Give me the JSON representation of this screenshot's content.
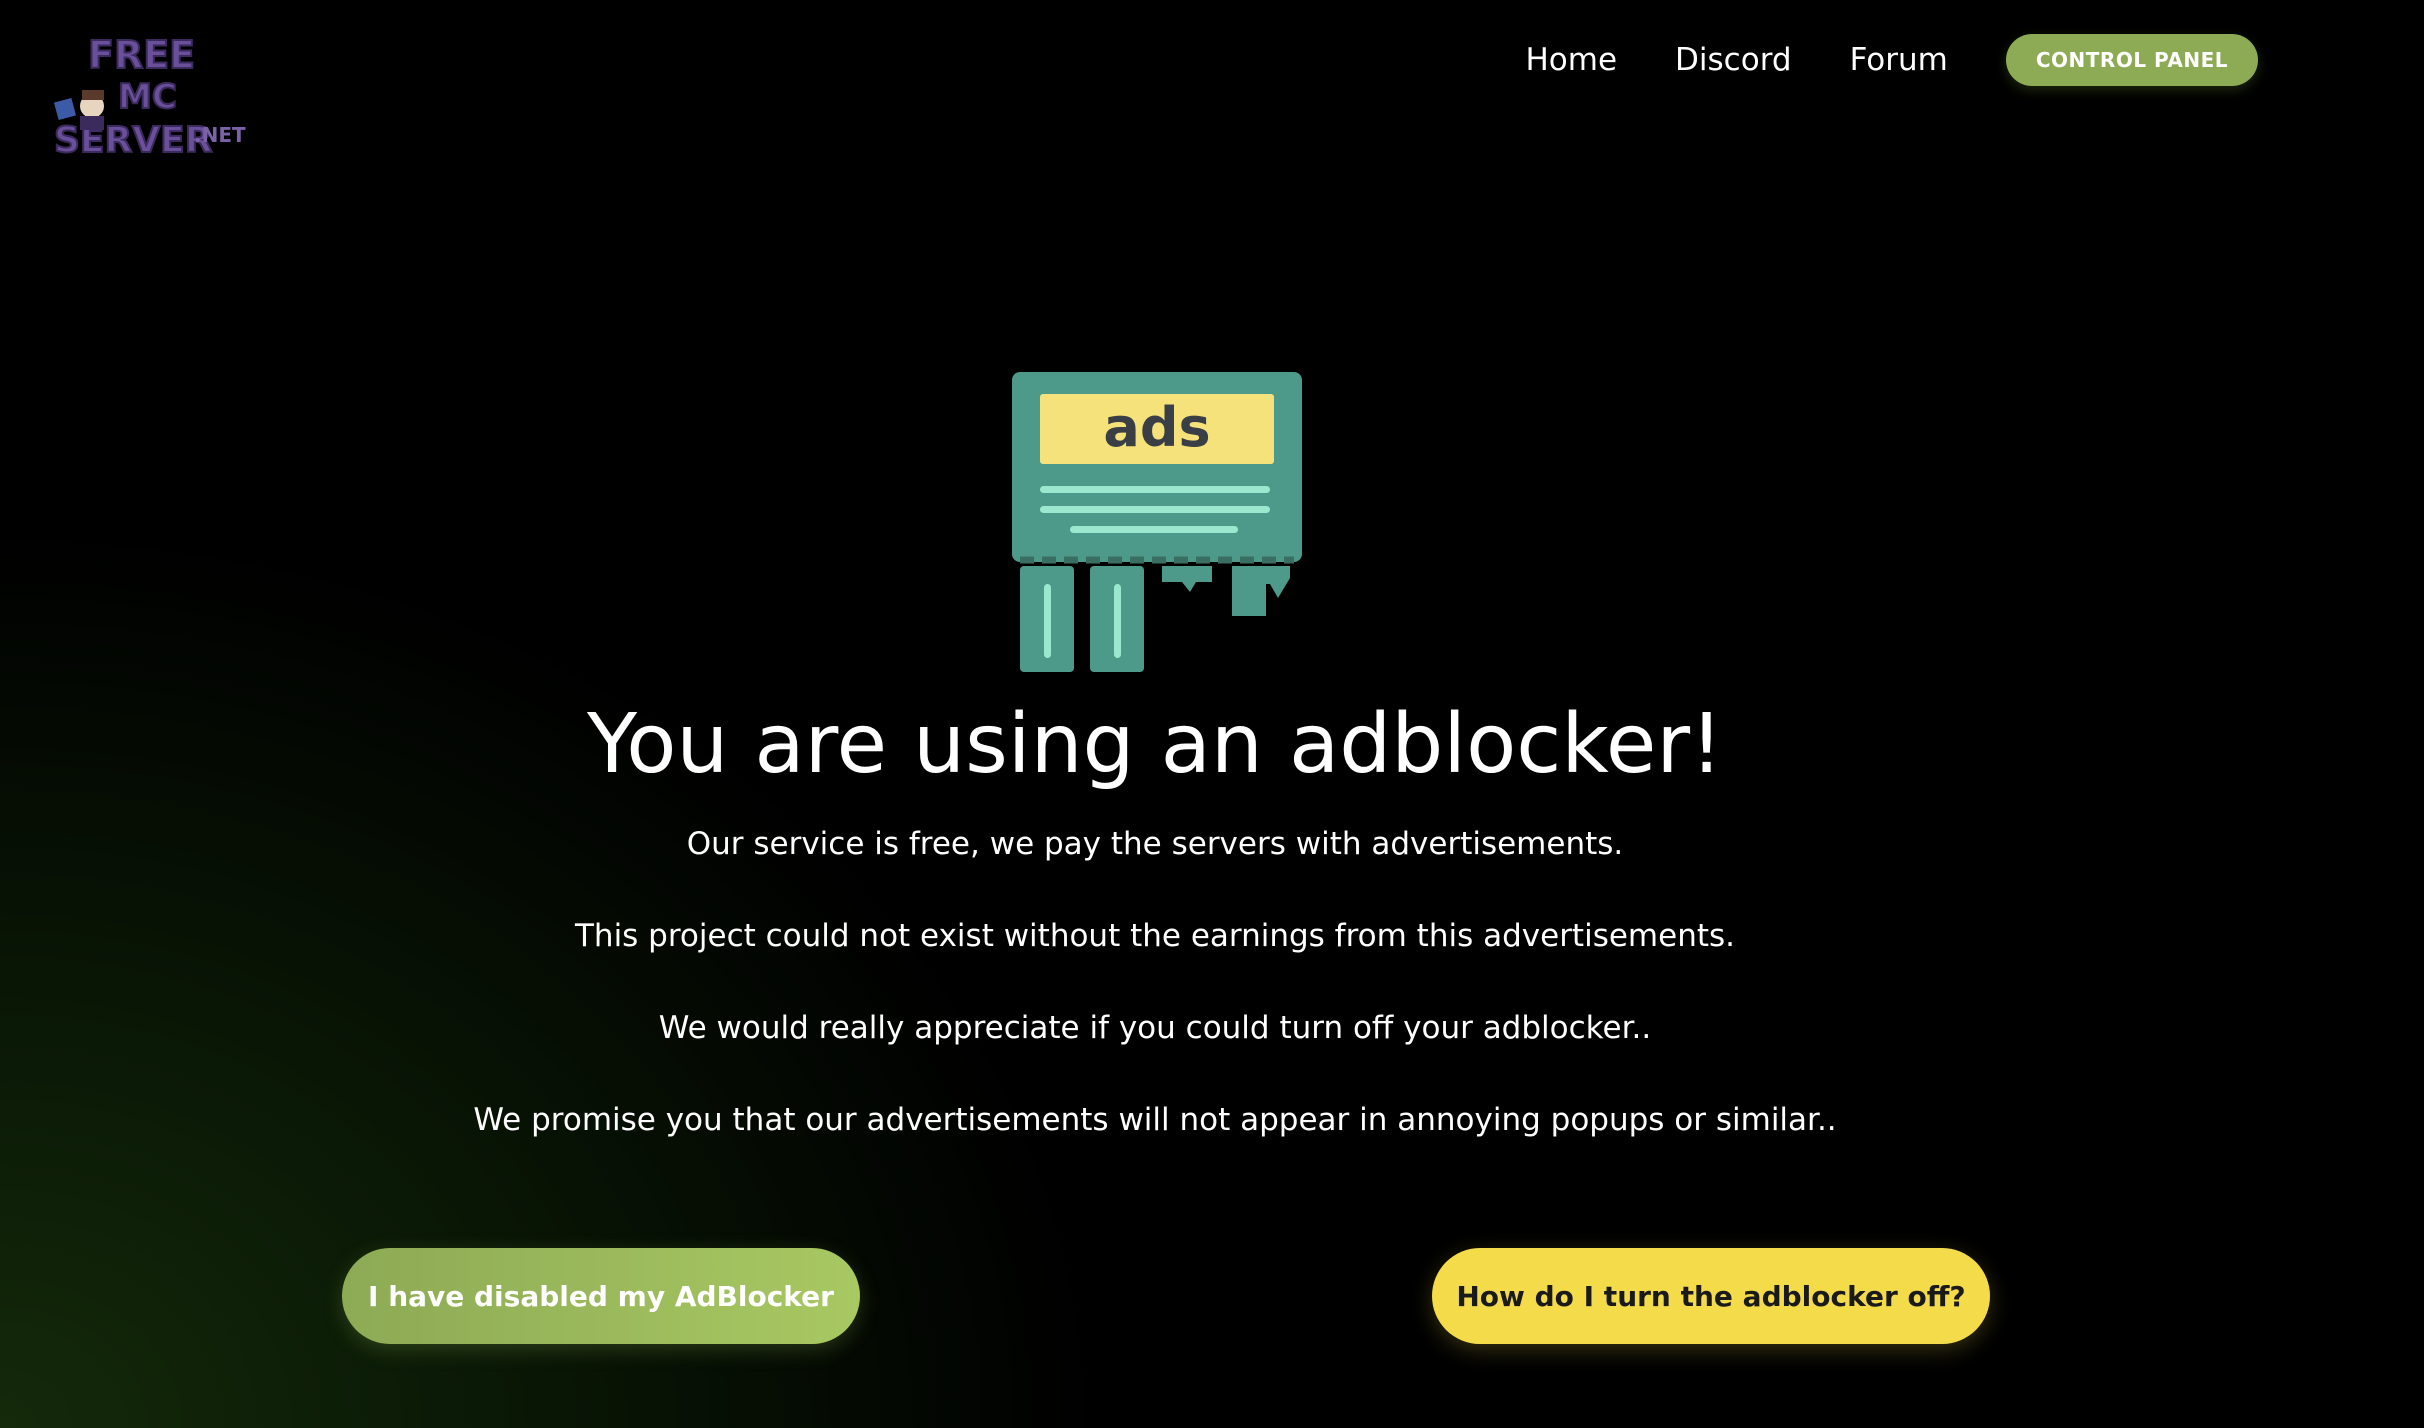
{
  "logo": {
    "line1": "FREE",
    "line2": "MC",
    "line3": "SERVER",
    "suffix": ".NET"
  },
  "nav": {
    "home": "Home",
    "discord": "Discord",
    "forum": "Forum",
    "control_panel": "CONTROL PANEL"
  },
  "hero": {
    "icon_label": "ads",
    "title": "You are using an adblocker!",
    "messages": [
      "Our service is free, we pay the servers with advertisements.",
      "This project could not exist without the earnings from this advertisements.",
      "We would really appreciate if you could turn off your adblocker..",
      "We promise you that our advertisements will not appear in annoying popups or similar.."
    ]
  },
  "actions": {
    "disabled_label": "I have disabled my AdBlocker",
    "howto_label": "How do I turn the adblocker off?"
  },
  "colors": {
    "accent_green": "#8daa55",
    "accent_yellow": "#f3db4a",
    "icon_teal": "#4e9a8a",
    "icon_mint": "#9be8cf",
    "logo_purple": "#6a4f9a"
  }
}
